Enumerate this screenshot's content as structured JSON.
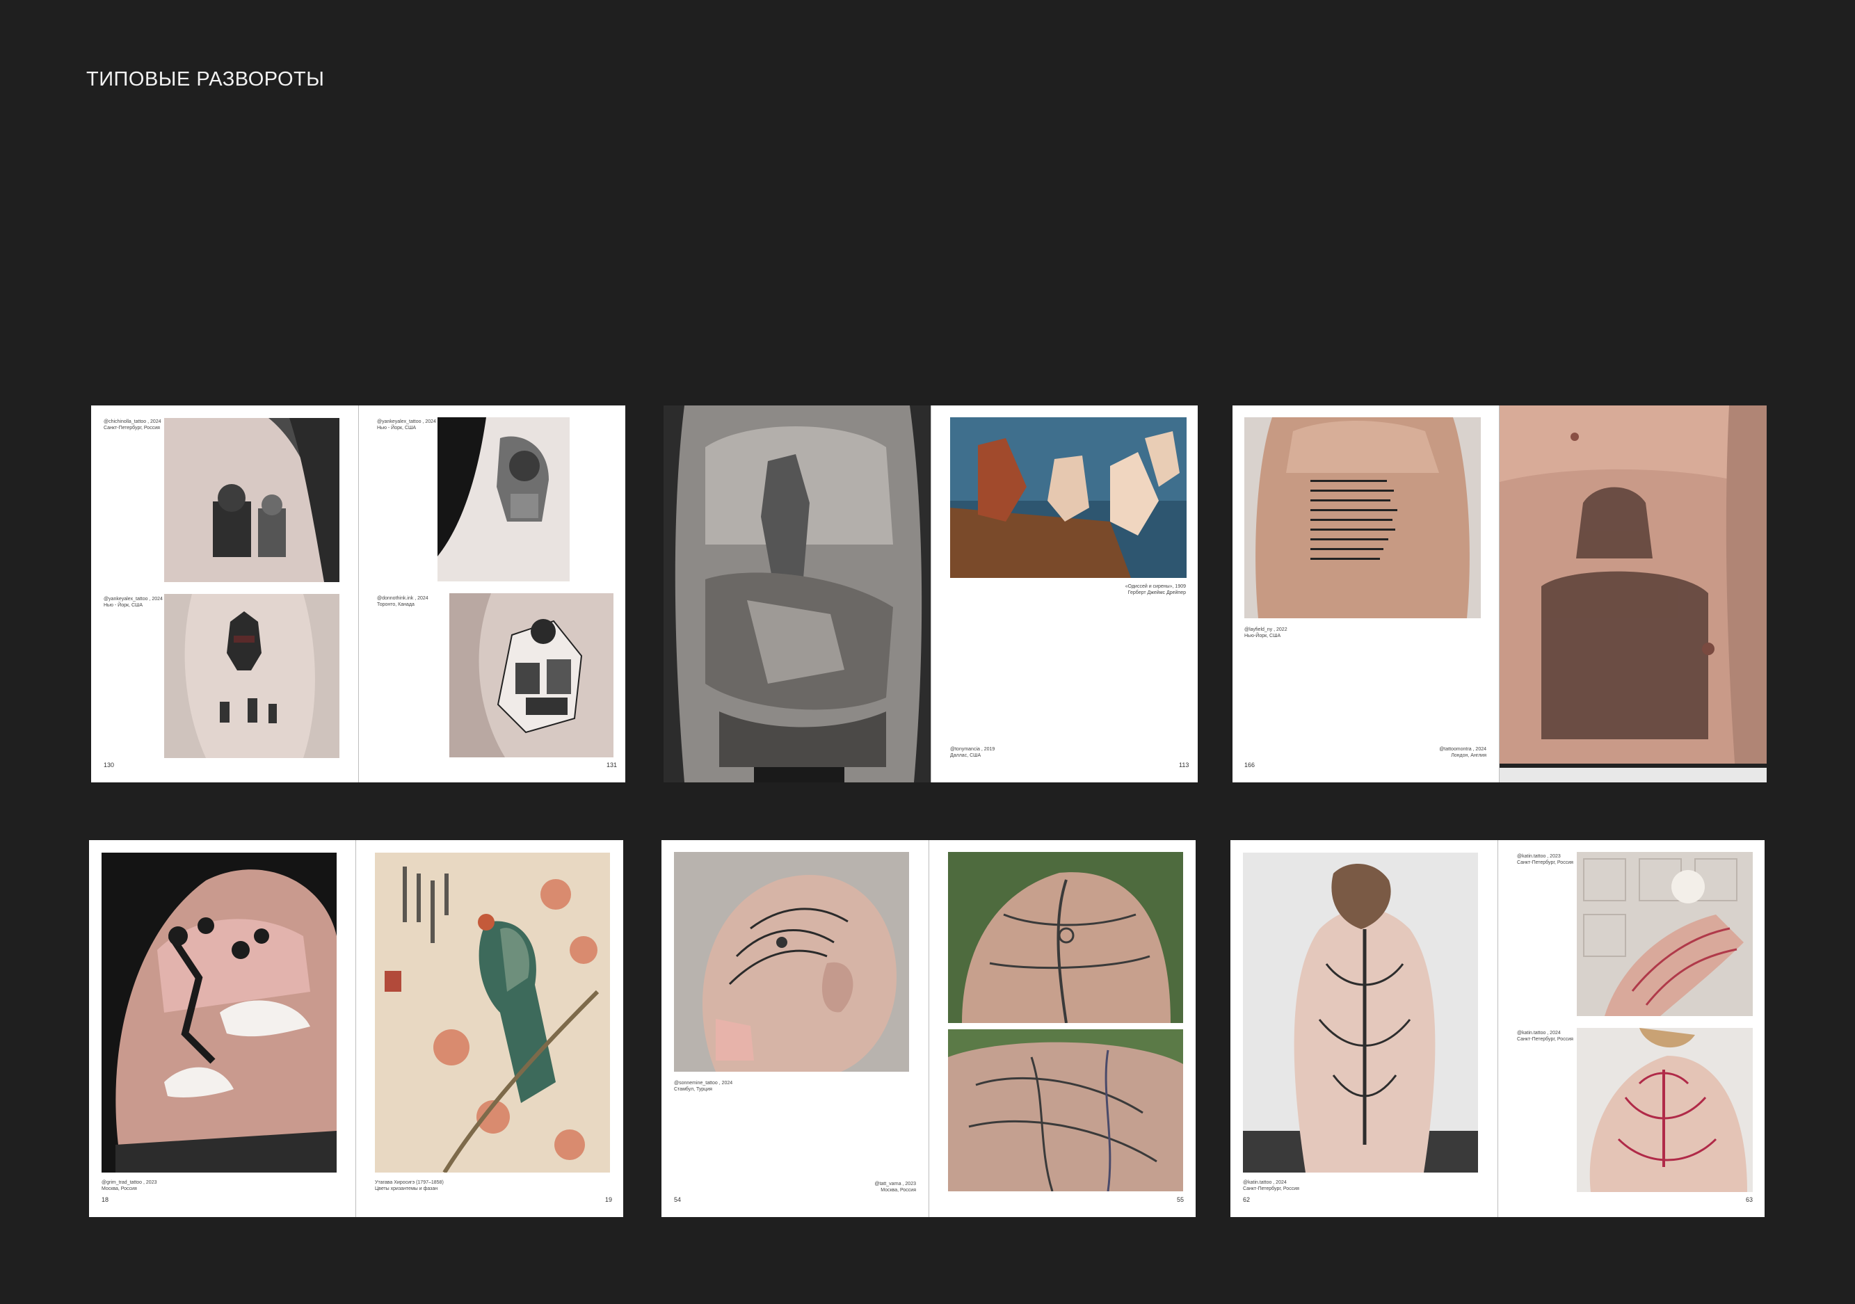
{
  "heading": "ТИПОВЫЕ РАЗВОРОТЫ",
  "spreads": [
    {
      "left": {
        "page_number": "130",
        "captions": [
          {
            "line1": "@chichinolla_tattoo , 2024",
            "line2": "Санкт-Петербург, Россия"
          },
          {
            "line1": "@yankeyalex_tattoo , 2024",
            "line2": "Нью - Йорк, США"
          }
        ]
      },
      "right": {
        "page_number": "131",
        "captions": [
          {
            "line1": "@yankeyalex_tattoo , 2024",
            "line2": "Нью - Йорк, США"
          },
          {
            "line1": "@donnothink.ink , 2024",
            "line2": "Торонто, Канада"
          }
        ]
      }
    },
    {
      "left": {
        "page_number": "",
        "captions": []
      },
      "right": {
        "page_number": "113",
        "captions": [
          {
            "line1": "«Одиссей и сирены», 1909",
            "line2": "Герберт Джеймс Дрейпер"
          },
          {
            "line1": "@tonymancia , 2019",
            "line2": "Даллас, США"
          }
        ]
      }
    },
    {
      "left": {
        "page_number": "166",
        "captions": [
          {
            "line1": "@layfield_ny , 2022",
            "line2": "Нью-Йорк, США"
          },
          {
            "line1": "@tattoomontra , 2024",
            "line2": "Лондон, Англия"
          }
        ]
      },
      "right": {
        "page_number": "",
        "captions": []
      }
    },
    {
      "left": {
        "page_number": "18",
        "captions": [
          {
            "line1": "@grim_trad_tattoo , 2023",
            "line2": "Москва, Россия"
          }
        ]
      },
      "right": {
        "page_number": "19",
        "captions": [
          {
            "line1": "Утагава Хиросигэ (1797–1858)",
            "line2": "Цветы хризантемы и фазан"
          }
        ]
      }
    },
    {
      "left": {
        "page_number": "54",
        "captions": [
          {
            "line1": "@sonnemine_tattoo , 2024",
            "line2": "Стамбул, Турция"
          },
          {
            "line1": "@tatt_varna , 2023",
            "line2": "Москва, Россия"
          }
        ]
      },
      "right": {
        "page_number": "55",
        "captions": []
      }
    },
    {
      "left": {
        "page_number": "62",
        "captions": [
          {
            "line1": "@katin.tattoo , 2024",
            "line2": "Санкт-Петербург, Россия"
          }
        ]
      },
      "right": {
        "page_number": "63",
        "captions": [
          {
            "line1": "@katin.tattoo , 2023",
            "line2": "Санкт-Петербург, Россия"
          },
          {
            "line1": "@katin.tattoo , 2024",
            "line2": "Санкт-Петербург, Россия"
          }
        ]
      }
    }
  ]
}
